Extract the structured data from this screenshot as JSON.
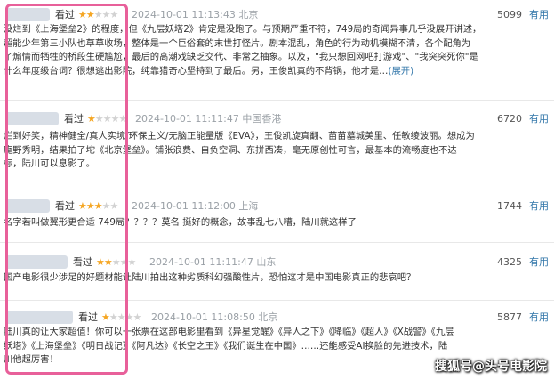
{
  "reviews": [
    {
      "watched": "看过",
      "rating": 2,
      "time": "2024-10-01 11:13:43",
      "location": "北京",
      "votes": "5099",
      "useful_label": "有用",
      "lines": [
        "没烂到《上海堡垒2》的程度，但《九层妖塔2》肯定是没跑了。与预期严重不符，749局的奇闻异事几乎没展开讲述，",
        "超能少年第三小队也草草收场，整体是一个巨俗套的末世打怪片。剧本混乱，角色的行为动机模糊不清，各个配角为",
        "了煽情而牺牲的桥段生硬尴尬，最后的高潮戏缺乏交代、非常之抽象。以及，\"我只想回网吧打游戏\"、\"我突突死你\"是",
        "什么年度级台词？很想逃出影院，纯靠猎奇心坚持到了最后。另，王俊凯真的不背锅，他才是…"
      ],
      "expand_label": "(展开)"
    },
    {
      "watched": "看过",
      "rating": 1,
      "time": "2024-10-01 11:11:47",
      "location": "中国香港",
      "votes": "6720",
      "useful_label": "有用",
      "lines": [
        "烂到好笑，精神健全/真人实境/环保主义/无脑正能量版《EVA》，王俊凯旋真翻、苗苗墓城美里、任敏绫波丽。想成为",
        "庵野秀明，结果拍了坨《北京堡垒》。铺张浪费、自负空洞、东拼西凑，毫无原创性可言，最基本的流畅度也不达",
        "标，陆川可以息影了。"
      ]
    },
    {
      "watched": "看过",
      "rating": 3,
      "time": "2024-10-01 11:12:00",
      "location": "上海",
      "votes": "1744",
      "useful_label": "有用",
      "lines": [
        "名字若叫做翼形更合适 749局？？？？莫名 挺好的概念，故事乱七八糟，陆川就这样了"
      ]
    },
    {
      "watched": "看过",
      "rating": 2,
      "time": "2024-10-01 11:11:47",
      "location": "山东",
      "votes": "4325",
      "useful_label": "有用",
      "lines": [
        "国产电影很少涉足的好题材能让陆川拍出这种劣质科幻强酸性片，恐怕这才是中国电影真正的悲哀吧？"
      ]
    },
    {
      "watched": "看过",
      "rating": 1,
      "time": "2024-10-01 11:08:50",
      "location": "北京",
      "votes": "5877",
      "useful_label": "有用",
      "lines": [
        "陆川真的让大家超值！你可以一张票在这部电影里看到《异星觉醒》《异人之下》《降临》《超人》《X战警》《九层",
        "妖塔》《上海堡垒》《明日战记》《阿凡达》《长空之王》《我们诞生在中国》……还能感受AI换脸的先进技术，陆",
        "川他超厉害！"
      ]
    }
  ],
  "watermark": "搜狐号@头号电影院"
}
